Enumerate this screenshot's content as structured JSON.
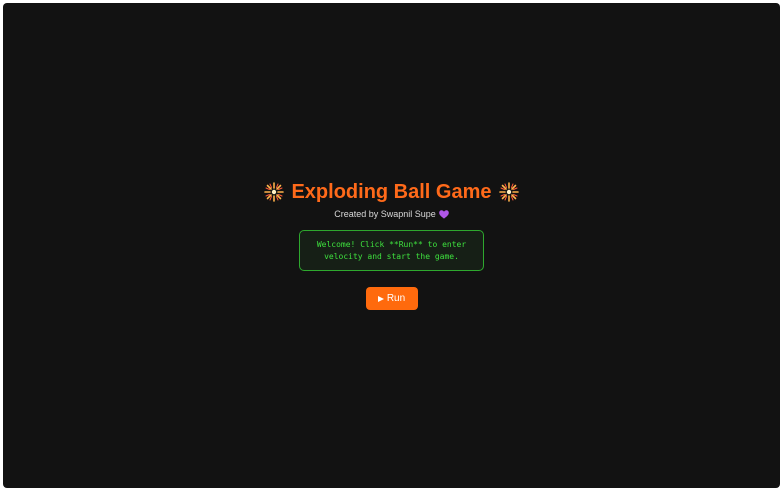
{
  "game": {
    "title": "Exploding Ball Game",
    "subtitle": "Created by Swapnil Supe",
    "console_message": "Welcome! Click **Run** to enter velocity and start the game.",
    "run_label": "Run"
  },
  "icons": {
    "title_left": "firework-burst-icon",
    "title_right": "firework-burst-icon",
    "subtitle_trailing": "purple-heart-icon",
    "run_button": "play-icon"
  },
  "colors": {
    "background": "#121212",
    "title": "#ff6a1a",
    "console_border": "#2ea82e",
    "console_text": "#3ee03e",
    "run_button": "#ff6a0d",
    "heart": "#b057e8"
  }
}
